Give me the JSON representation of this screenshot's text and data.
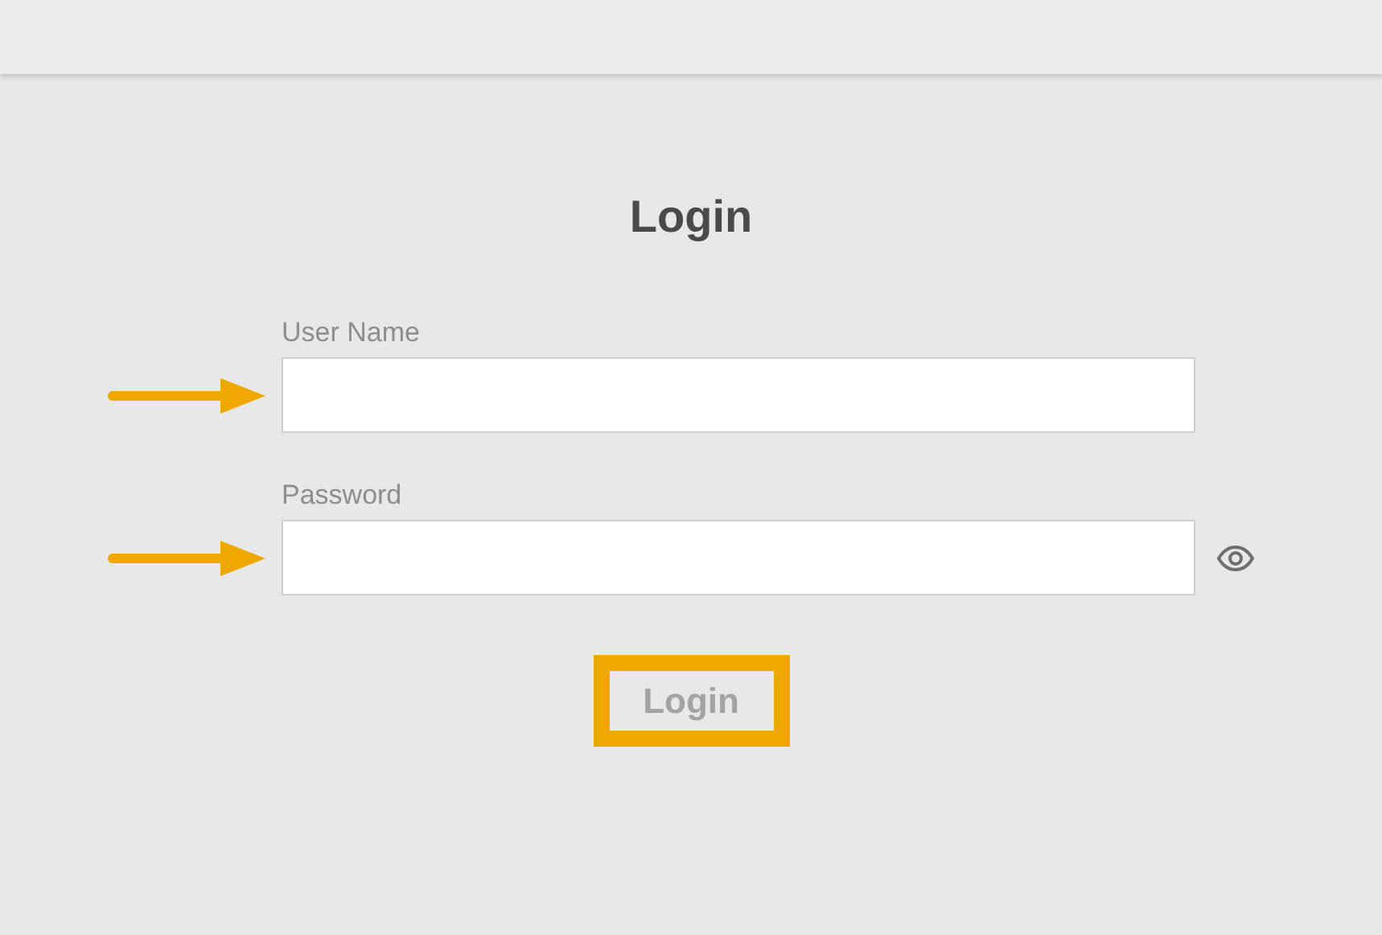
{
  "title": "Login",
  "fields": [
    {
      "label": "User Name",
      "kind": "text"
    },
    {
      "label": "Password",
      "kind": "password"
    }
  ],
  "login_button": {
    "label": "Login",
    "disabled": true
  }
}
